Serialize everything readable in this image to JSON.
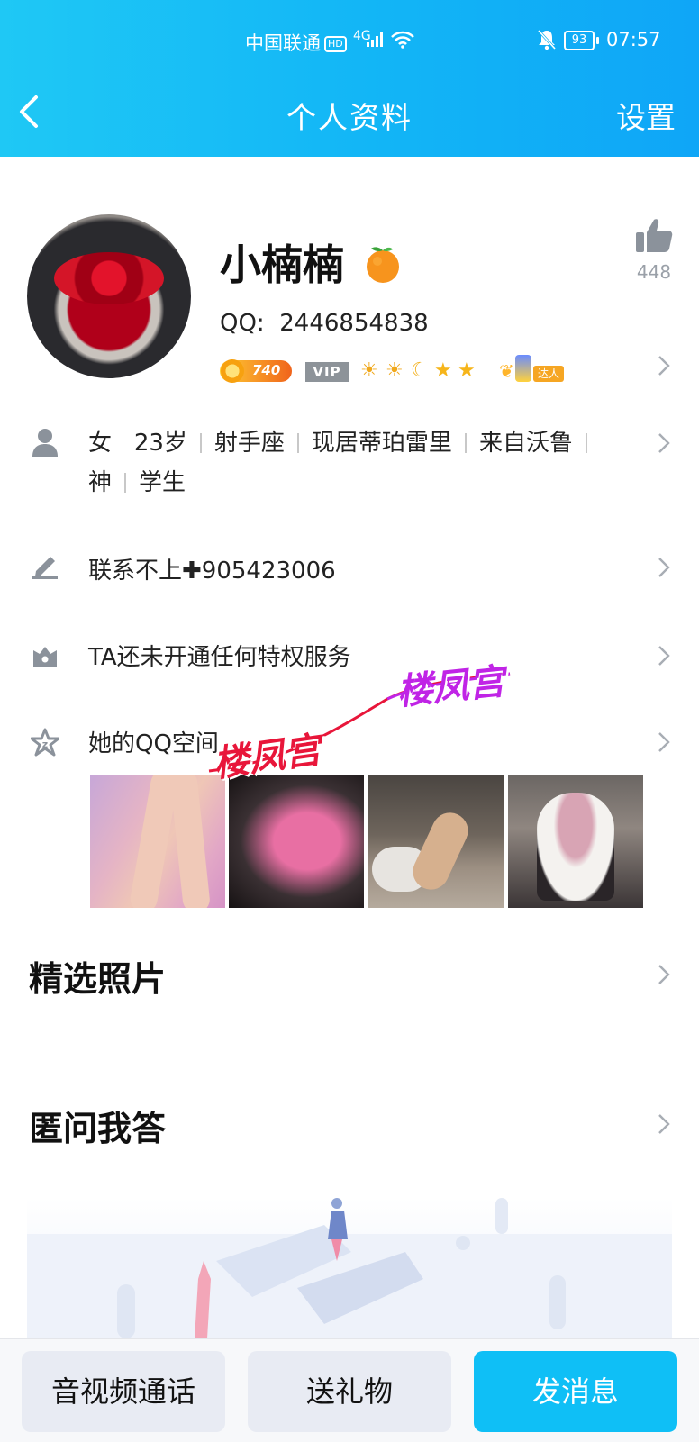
{
  "status_bar": {
    "carrier": "中国联通",
    "hd": "HD",
    "network": "4G",
    "battery": "93",
    "time": "07:57"
  },
  "nav": {
    "title": "个人资料",
    "settings": "设置"
  },
  "profile": {
    "nickname": "小楠楠",
    "qq_label": "QQ:",
    "qq_number": "2446854838",
    "likes": "448",
    "coin_level": "740",
    "vip": "VIP",
    "level_icons": [
      "☀",
      "☀",
      "☾",
      "★",
      "★"
    ],
    "badge_text": "达人"
  },
  "info": {
    "line1": [
      "女",
      "23岁",
      "射手座",
      "现居蒂珀雷里",
      "来自沃鲁"
    ],
    "line2": [
      "神",
      "学生"
    ],
    "signature": "联系不上✚905423006",
    "privilege": "TA还未开通任何特权服务",
    "qzone": "她的QQ空间"
  },
  "watermark": "楼凤宫",
  "sections": {
    "featured_photos": "精选照片",
    "anonymous_qa": "匿问我答"
  },
  "bottom_bar": {
    "call": "音视频通话",
    "gift": "送礼物",
    "message": "发消息"
  },
  "colors": {
    "header": "#12b5f6",
    "primary_button": "#0fbff6",
    "secondary_button": "#e8ebf3"
  }
}
